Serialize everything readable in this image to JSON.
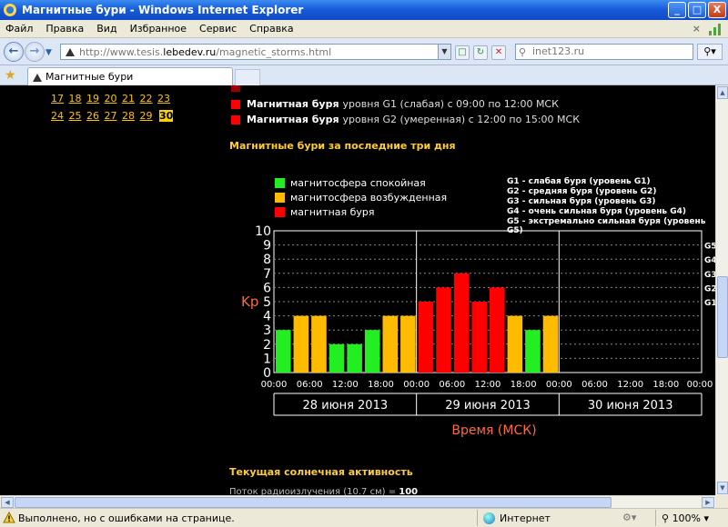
{
  "window": {
    "title": "Магнитные бури - Windows Internet Explorer",
    "min_label": "_",
    "max_label": "□",
    "close_label": "X"
  },
  "menu": [
    "Файл",
    "Правка",
    "Вид",
    "Избранное",
    "Сервис",
    "Справка"
  ],
  "menu_close": "×",
  "address": {
    "url_prefix": "http://www.tesis.",
    "url_domain": "lebedev.ru",
    "url_suffix": "/magnetic_storms.html",
    "search_value": "inet123.ru"
  },
  "tab": {
    "title": "Магнитные бури"
  },
  "page": {
    "calendar_rows": [
      [
        "17",
        "18",
        "19",
        "20",
        "21",
        "22",
        "23"
      ],
      [
        "24",
        "25",
        "26",
        "27",
        "28",
        "29"
      ]
    ],
    "calendar_today": "30",
    "storm_lines": [
      {
        "strong": "Магнитная буря",
        "text": "уровня G1 (слабая) с 09:00 по 12:00 МСК"
      },
      {
        "strong": "Магнитная буря",
        "text": "уровня G2 (умеренная) с 12:00 по 15:00 МСК"
      }
    ],
    "section_title": "Магнитные бури за последние три дня",
    "legend": [
      {
        "label": "магнитосфера спокойная",
        "color": "#22ee22"
      },
      {
        "label": "магнитосфера возбужденная",
        "color": "#ffbb00"
      },
      {
        "label": "магнитная буря",
        "color": "#ff0000"
      }
    ],
    "scale": [
      "G1 - слабая буря (уровень G1)",
      "G2 - средняя буря (уровень G2)",
      "G3 - сильная буря (уровень G3)",
      "G4 - очень сильная буря (уровень G4)",
      "G5 - экстремально сильная буря (уровень G5)"
    ],
    "section_title_2": "Текущая солнечная активность",
    "radio_flux_label": "Поток радиоизлучения (10.7 см) =",
    "radio_flux_value": "100"
  },
  "chart_data": {
    "type": "bar",
    "ylabel": "Kp",
    "xlabel": "Время (МСК)",
    "ylim": [
      0,
      10
    ],
    "y_ticks": [
      "0",
      "1",
      "2",
      "3",
      "4",
      "5",
      "6",
      "7",
      "8",
      "9",
      "10"
    ],
    "g_marks": [
      {
        "label": "G1",
        "kp": 5
      },
      {
        "label": "G2",
        "kp": 6
      },
      {
        "label": "G3",
        "kp": 7
      },
      {
        "label": "G4",
        "kp": 8
      },
      {
        "label": "G5",
        "kp": 9
      }
    ],
    "days": [
      "28 июня 2013",
      "29 июня 2013",
      "30 июня 2013"
    ],
    "time_ticks": [
      "00:00",
      "06:00",
      "12:00",
      "18:00"
    ],
    "last_tick": "00:00",
    "bar_colors": {
      "quiet": "#22ee22",
      "active": "#ffbb00",
      "storm": "#ff0000"
    },
    "values": [
      [
        3,
        4,
        4,
        2,
        2,
        3,
        4,
        4
      ],
      [
        5,
        6,
        7,
        5,
        6,
        4,
        3,
        4
      ],
      []
    ]
  },
  "status": {
    "text": "Выполнено, но с ошибками на странице.",
    "zone": "Интернет",
    "zoom": "100%"
  }
}
